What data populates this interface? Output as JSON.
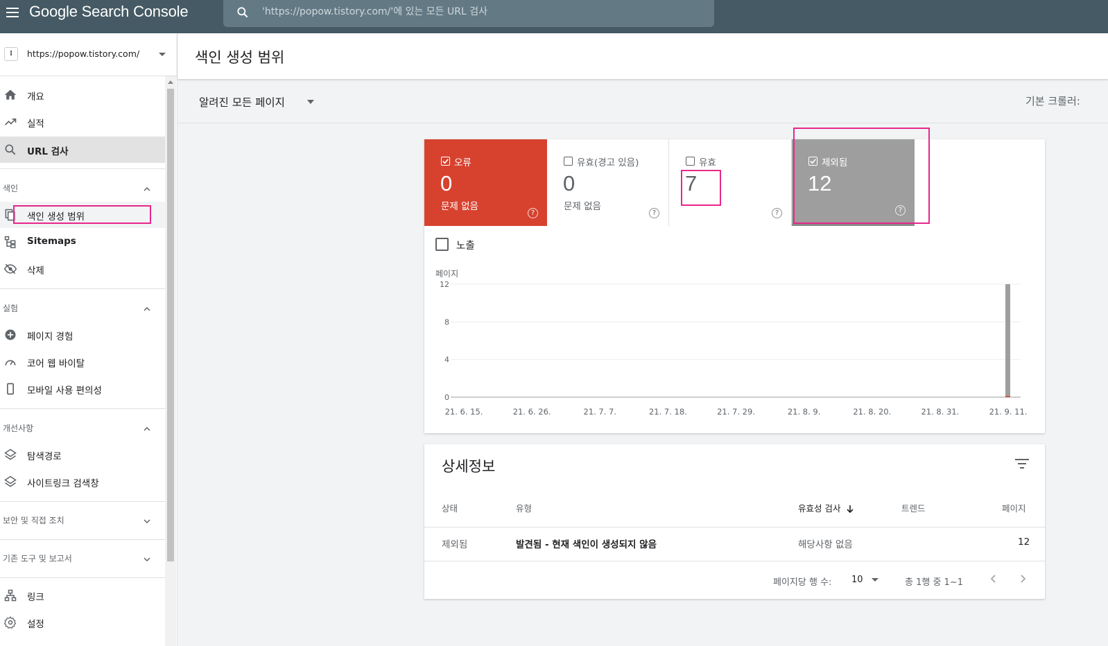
{
  "app": {
    "brand": "Google Search Console",
    "search_placeholder": "'https://popow.tistory.com/'에 있는 모든 URL 검사"
  },
  "sidebar": {
    "property_url": "https://popow.tistory.com/",
    "items_main": [
      {
        "label": "개요",
        "icon": "home-icon"
      },
      {
        "label": "실적",
        "icon": "trending-up-icon"
      },
      {
        "label": "URL 검사",
        "icon": "search-icon"
      }
    ],
    "section_index": {
      "label": "색인",
      "items": [
        {
          "label": "색인 생성 범위",
          "icon": "file-copy-icon"
        },
        {
          "label": "Sitemaps",
          "icon": "sitemap-icon"
        },
        {
          "label": "삭제",
          "icon": "visibility-off-icon"
        }
      ]
    },
    "section_experience": {
      "label": "실험",
      "items": [
        {
          "label": "페이지 경험",
          "icon": "add-circle-icon"
        },
        {
          "label": "코어 웹 바이탈",
          "icon": "speed-icon"
        },
        {
          "label": "모바일 사용 편의성",
          "icon": "smartphone-icon"
        }
      ]
    },
    "section_enhancements": {
      "label": "개선사항",
      "items": [
        {
          "label": "탐색경로",
          "icon": "layers-icon"
        },
        {
          "label": "사이트링크 검색창",
          "icon": "layers-icon"
        }
      ]
    },
    "section_security": {
      "label": "보안 및 직접 조치"
    },
    "section_legacy": {
      "label": "기존 도구 및 보고서"
    },
    "items_bottom": [
      {
        "label": "링크",
        "icon": "links-icon"
      },
      {
        "label": "설정",
        "icon": "settings-icon"
      }
    ]
  },
  "main": {
    "title": "색인 생성 범위",
    "filter": "알려진 모든 페이지",
    "crawler_label": "기본 크롤러:"
  },
  "summary": {
    "tiles": [
      {
        "label": "오류",
        "value": "0",
        "sub": "문제 없음",
        "checked": true,
        "color": "#d7422f"
      },
      {
        "label": "유효(경고 있음)",
        "value": "0",
        "sub": "문제 없음",
        "checked": false,
        "color": "#ffffff"
      },
      {
        "label": "유효",
        "value": "7",
        "sub": "",
        "checked": false,
        "color": "#ffffff"
      },
      {
        "label": "제외됨",
        "value": "12",
        "sub": "",
        "checked": true,
        "color": "#9e9e9e"
      }
    ],
    "impressions_label": "노출"
  },
  "chart_data": {
    "type": "bar",
    "ylabel": "페이지",
    "ylim": [
      0,
      12
    ],
    "yticks": [
      "0",
      "4",
      "8",
      "12"
    ],
    "x_tick_labels": [
      "21. 6. 15.",
      "21. 6. 26.",
      "21. 7. 7.",
      "21. 7. 18.",
      "21. 7. 29.",
      "21. 8. 9.",
      "21. 8. 20.",
      "21. 8. 31.",
      "21. 9. 11."
    ],
    "series": [
      {
        "color": "#9e9e9e",
        "points": [
          {
            "x": "21. 9. 11.",
            "y": 12
          }
        ]
      },
      {
        "color": "#d7422f",
        "points": [
          {
            "x": "21. 9. 11.",
            "y": 0
          }
        ]
      }
    ],
    "grid": true
  },
  "details": {
    "title": "상세정보",
    "columns": [
      "상태",
      "유형",
      "유효성 검사",
      "트렌드",
      "페이지"
    ],
    "rows": [
      {
        "status": "제외됨",
        "type": "발견됨 - 현재 색인이 생성되지 않음",
        "validation": "해당사항 없음",
        "trend": "",
        "pages": "12"
      }
    ],
    "pager": {
      "rows_per_page_label": "페이지당 행 수:",
      "rows_per_page": "10",
      "range": "총 1행 중 1~1"
    }
  }
}
